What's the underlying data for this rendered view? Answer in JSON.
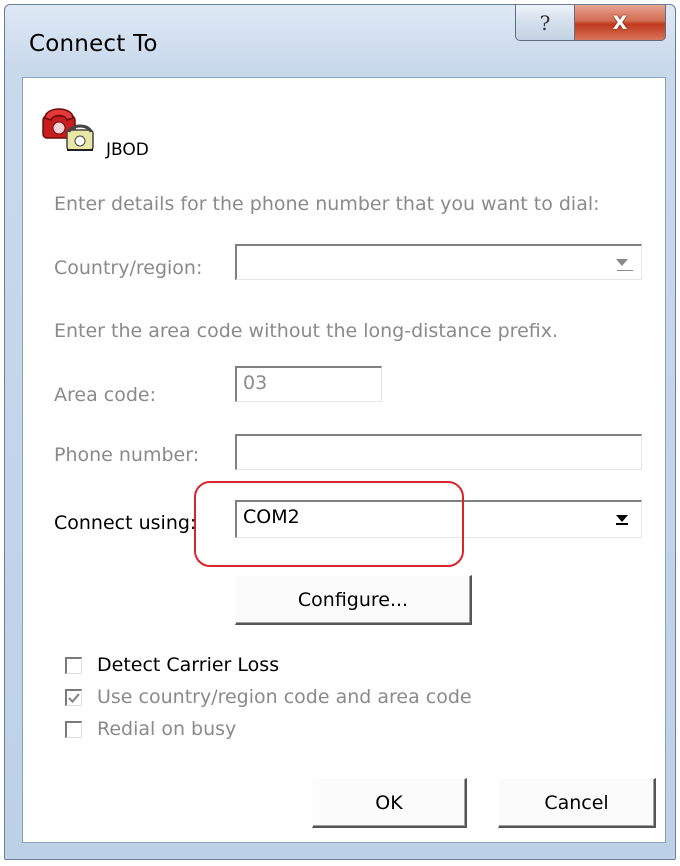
{
  "window": {
    "title": "Connect To",
    "help_glyph": "?",
    "close_glyph": "X"
  },
  "connection": {
    "name": "JBOD",
    "icon": "phone-connection-icon"
  },
  "instructions": {
    "dial_details": "Enter details for the phone number that you want to dial:",
    "area_hint": "Enter the area code without the long-distance prefix."
  },
  "form": {
    "country_label": "Country/region:",
    "country_value": "",
    "area_code_label": "Area code:",
    "area_code_value": "03",
    "phone_label": "Phone number:",
    "phone_value": "",
    "connect_using_label": "Connect using:",
    "connect_using_value": "COM2"
  },
  "buttons": {
    "configure": "Configure...",
    "ok": "OK",
    "cancel": "Cancel"
  },
  "options": [
    {
      "label": "Detect Carrier Loss",
      "checked": false,
      "enabled": true
    },
    {
      "label": "Use country/region code and area code",
      "checked": true,
      "enabled": false
    },
    {
      "label": "Redial on busy",
      "checked": false,
      "enabled": false
    }
  ],
  "colors": {
    "highlight": "#d9242a",
    "disabled_text": "#8a8a8a"
  }
}
